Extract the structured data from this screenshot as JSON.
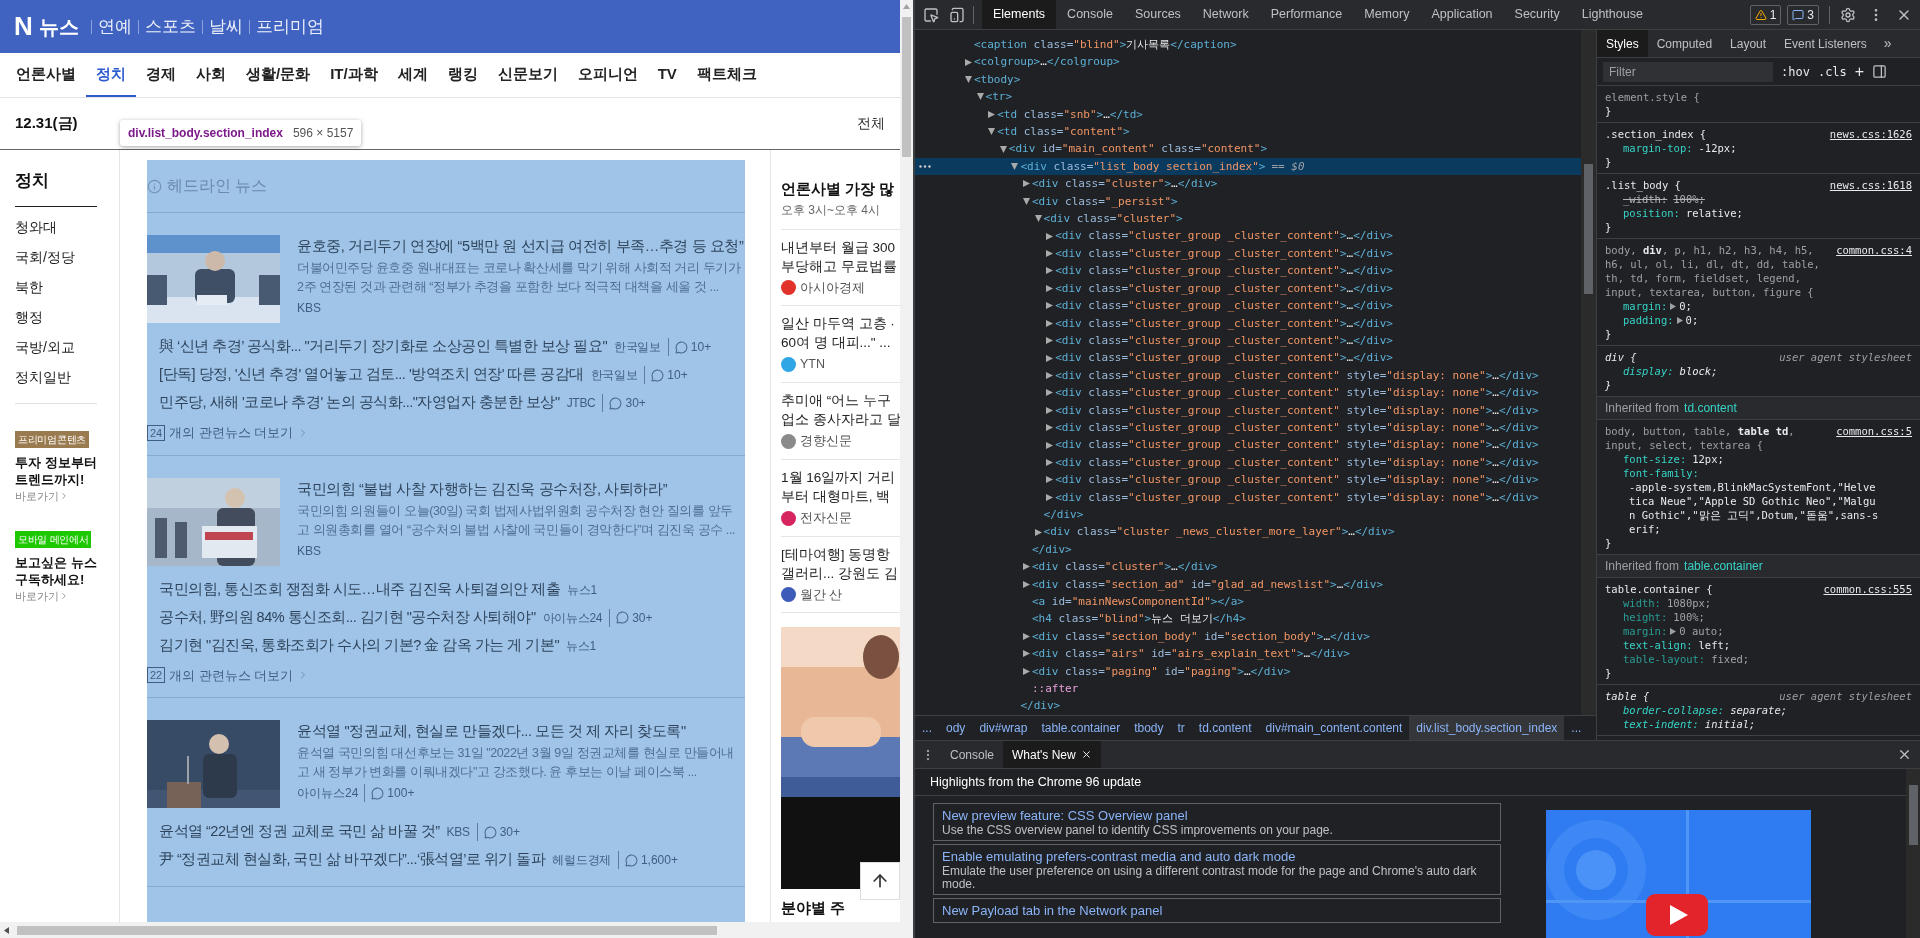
{
  "page": {
    "header": {
      "logo": "N",
      "title": "뉴스",
      "links": [
        "연예",
        "스포츠",
        "날씨",
        "프리미엄"
      ]
    },
    "nav": [
      {
        "label": "언론사별",
        "selected": false
      },
      {
        "label": "정치",
        "selected": true
      },
      {
        "label": "경제",
        "selected": false
      },
      {
        "label": "사회",
        "selected": false
      },
      {
        "label": "생활/문화",
        "selected": false
      },
      {
        "label": "IT/과학",
        "selected": false
      },
      {
        "label": "세계",
        "selected": false
      },
      {
        "label": "랭킹",
        "selected": false
      },
      {
        "label": "신문보기",
        "selected": false
      },
      {
        "label": "오피니언",
        "selected": false
      },
      {
        "label": "TV",
        "selected": false
      },
      {
        "label": "팩트체크",
        "selected": false
      }
    ],
    "date": "12.31(금)",
    "view_all": "전체",
    "inspect_tooltip": {
      "selector": "div.list_body.section_index",
      "size": "596 × 5157"
    },
    "sidebar": {
      "heading": "정치",
      "items": [
        "청와대",
        "국회/정당",
        "북한",
        "행정",
        "국방/외교",
        "정치일반"
      ],
      "promos": [
        {
          "badge": "프리미엄콘텐츠",
          "color": "#9a7a4f",
          "text": "투자 정보부터 트렌드까지!",
          "link": "바로가기"
        },
        {
          "badge": "모바일 메인에서",
          "color": "#1ec800",
          "text": "보고싶은 뉴스 구독하세요!",
          "link": "바로가기"
        }
      ]
    },
    "headline": {
      "title": "헤드라인 뉴스",
      "clusters": [
        {
          "title": "윤호중, 거리두기 연장에 “5백만 원 선지급 여전히 부족…추경 등 요청”",
          "summary": "더불어민주당 윤호중 원내대표는 코로나 확산세를 막기 위해 사회적 거리 두기가 2주 연장된 것과 관련해 “정부가 추경을 포함한 보다 적극적 대책을 세울 것 ...",
          "press": "KBS",
          "related": [
            {
              "title": "與 ‘신년 추경’ 공식화... \"거리두기 장기화로 소상공인 특별한 보상 필요\"",
              "press": "한국일보",
              "comments": "10+"
            },
            {
              "title": "[단독] 당정, '신년 추경' 열어놓고 검토... '방역조치 연장' 따른 공감대",
              "press": "한국일보",
              "comments": "10+"
            },
            {
              "title": "민주당, 새해 '코로나 추경' 논의 공식화...\"자영업자 충분한 보상\"",
              "press": "JTBC",
              "comments": "30+"
            }
          ],
          "more_count": "24",
          "more_label": "개의 관련뉴스 더보기"
        },
        {
          "title": "국민의힘 “불법 사찰 자행하는 김진욱 공수처장, 사퇴하라”",
          "summary": "국민의힘 의원들이 오늘(30일) 국회 법제사법위원회 공수처장 현안 질의를 앞두고 의원총회를 열어 “공수처의 불법 사찰에 국민들이 경악한다”며 김진욱 공수 ...",
          "press": "KBS",
          "related": [
            {
              "title": "국민의힘, 통신조회 쟁점화 시도…내주 김진욱 사퇴결의안 제출",
              "press": "뉴스1"
            },
            {
              "title": "공수처, 野의원 84% 통신조회... 김기현 \"공수처장 사퇴해야\"",
              "press": "아이뉴스24",
              "comments": "30+"
            },
            {
              "title": "김기현 \"김진욱, 통화조회가 수사의 기본? 金 감옥 가는 게 기본\"",
              "press": "뉴스1"
            }
          ],
          "more_count": "22",
          "more_label": "개의 관련뉴스 더보기"
        },
        {
          "title": "윤석열 \"정권교체, 현실로 만들겠다... 모든 것 제 자리 찾도록\"",
          "summary": "윤석열 국민의힘 대선후보는 31일 \"2022년 3월 9일 정권교체를 현실로 만들어내고 새 정부가 변화를 이뤄내겠다\"고 강조했다. 윤 후보는 이날 페이스북 ...",
          "press": "아이뉴스24",
          "comments": "100+",
          "related": [
            {
              "title": "윤석열 “22년엔 정권 교체로 국민 삶 바꿀 것”",
              "press": "KBS",
              "comments": "30+"
            },
            {
              "title": "尹 “정권교체 현실화, 국민 삶 바꾸겠다”...‘張석열’로 위기 돌파",
              "press": "헤럴드경제",
              "comments": "1,600+"
            }
          ]
        }
      ]
    },
    "ranking": {
      "title": "언론사별 가장 많",
      "subtitle": "오후 3시~오후 4시",
      "items": [
        {
          "lines": [
            "내년부터 월급 300",
            "부당해고 무료법률"
          ],
          "press": "아시아경제",
          "color": "#e0322b"
        },
        {
          "lines": [
            "일산 마두역 고층 ·",
            "60여 명 대피...\" ..."
          ],
          "press": "YTN",
          "color": "#2ea6e6"
        },
        {
          "lines": [
            "추미애 “어느 누구",
            "업소 종사자라고 달"
          ],
          "press": "경향신문",
          "color": "#8a8a8a"
        },
        {
          "lines": [
            "1월 16일까지 거리",
            "부터 대형마트, 백"
          ],
          "press": "전자신문",
          "color": "#d6245e"
        },
        {
          "lines": [
            "[테마여행] 동명항",
            "갤러리... 강원도 김"
          ],
          "press": "월간 산",
          "color": "#3d5bb8"
        }
      ],
      "section_title": "분야별 주"
    }
  },
  "devtools": {
    "tabs": [
      {
        "label": "Elements",
        "selected": true
      },
      {
        "label": "Console",
        "selected": false
      },
      {
        "label": "Sources",
        "selected": false
      },
      {
        "label": "Network",
        "selected": false
      },
      {
        "label": "Performance",
        "selected": false
      },
      {
        "label": "Memory",
        "selected": false
      },
      {
        "label": "Application",
        "selected": false
      },
      {
        "label": "Security",
        "selected": false
      },
      {
        "label": "Lighthouse",
        "selected": false
      }
    ],
    "warnings": "1",
    "messages": "3",
    "dom_tree": [
      {
        "text": "<caption class=\"blind\">기사목록</caption>",
        "kind": "leaf",
        "selected": false
      },
      {
        "text": "<colgroup>…</colgroup>",
        "kind": "node",
        "expanded": false,
        "selected": false
      },
      {
        "text": "<tbody>",
        "kind": "node",
        "expanded": true,
        "selected": false,
        "children": [
          {
            "text": "<tr>",
            "kind": "node",
            "expanded": true,
            "selected": false,
            "children": [
              {
                "text": "<td class=\"snb\">…</td>",
                "kind": "node",
                "expanded": false,
                "selected": false
              },
              {
                "text": "<td class=\"content\">",
                "kind": "node",
                "expanded": true,
                "selected": false,
                "children": [
                  {
                    "text": "<div id=\"main_content\" class=\"content\">",
                    "kind": "node",
                    "expanded": true,
                    "selected": false,
                    "children": [
                      {
                        "text": "<div class=\"list_body section_index\">",
                        "kind": "node",
                        "expanded": true,
                        "selected": true,
                        "console_ref": "== $0",
                        "close": "</div>",
                        "children": [
                          {
                            "text": "<div class=\"cluster\">…</div>",
                            "kind": "node",
                            "expanded": false,
                            "selected": false
                          },
                          {
                            "text": "<div class=\"_persist\">",
                            "kind": "node",
                            "expanded": true,
                            "selected": false,
                            "close": "</div>",
                            "children": [
                              {
                                "text": "<div class=\"cluster\">",
                                "kind": "node",
                                "expanded": true,
                                "selected": false,
                                "close": "</div>",
                                "children": [
                                  {
                                    "text": "<div class=\"cluster_group _cluster_content\">…</div>",
                                    "kind": "node",
                                    "expanded": false,
                                    "selected": false
                                  },
                                  {
                                    "text": "<div class=\"cluster_group _cluster_content\">…</div>",
                                    "kind": "node",
                                    "expanded": false,
                                    "selected": false
                                  },
                                  {
                                    "text": "<div class=\"cluster_group _cluster_content\">…</div>",
                                    "kind": "node",
                                    "expanded": false,
                                    "selected": false
                                  },
                                  {
                                    "text": "<div class=\"cluster_group _cluster_content\">…</div>",
                                    "kind": "node",
                                    "expanded": false,
                                    "selected": false
                                  },
                                  {
                                    "text": "<div class=\"cluster_group _cluster_content\">…</div>",
                                    "kind": "node",
                                    "expanded": false,
                                    "selected": false
                                  },
                                  {
                                    "text": "<div class=\"cluster_group _cluster_content\">…</div>",
                                    "kind": "node",
                                    "expanded": false,
                                    "selected": false
                                  },
                                  {
                                    "text": "<div class=\"cluster_group _cluster_content\">…</div>",
                                    "kind": "node",
                                    "expanded": false,
                                    "selected": false
                                  },
                                  {
                                    "text": "<div class=\"cluster_group _cluster_content\">…</div>",
                                    "kind": "node",
                                    "expanded": false,
                                    "selected": false
                                  },
                                  {
                                    "text": "<div class=\"cluster_group _cluster_content\" style=\"display: none\">…</div>",
                                    "kind": "node",
                                    "expanded": false,
                                    "selected": false
                                  },
                                  {
                                    "text": "<div class=\"cluster_group _cluster_content\" style=\"display: none\">…</div>",
                                    "kind": "node",
                                    "expanded": false,
                                    "selected": false
                                  },
                                  {
                                    "text": "<div class=\"cluster_group _cluster_content\" style=\"display: none\">…</div>",
                                    "kind": "node",
                                    "expanded": false,
                                    "selected": false
                                  },
                                  {
                                    "text": "<div class=\"cluster_group _cluster_content\" style=\"display: none\">…</div>",
                                    "kind": "node",
                                    "expanded": false,
                                    "selected": false
                                  },
                                  {
                                    "text": "<div class=\"cluster_group _cluster_content\" style=\"display: none\">…</div>",
                                    "kind": "node",
                                    "expanded": false,
                                    "selected": false
                                  },
                                  {
                                    "text": "<div class=\"cluster_group _cluster_content\" style=\"display: none\">…</div>",
                                    "kind": "node",
                                    "expanded": false,
                                    "selected": false
                                  },
                                  {
                                    "text": "<div class=\"cluster_group _cluster_content\" style=\"display: none\">…</div>",
                                    "kind": "node",
                                    "expanded": false,
                                    "selected": false
                                  },
                                  {
                                    "text": "<div class=\"cluster_group _cluster_content\" style=\"display: none\">…</div>",
                                    "kind": "node",
                                    "expanded": false,
                                    "selected": false
                                  }
                                ]
                              },
                              {
                                "text": "<div class=\"cluster _news_cluster_more_layer\">…</div>",
                                "kind": "node",
                                "expanded": false,
                                "selected": false
                              }
                            ]
                          },
                          {
                            "text": "<div class=\"cluster\">…</div>",
                            "kind": "node",
                            "expanded": false,
                            "selected": false
                          },
                          {
                            "text": "<div class=\"section_ad\" id=\"glad_ad_newslist\">…</div>",
                            "kind": "node",
                            "expanded": false,
                            "selected": false
                          },
                          {
                            "text": "<a id=\"mainNewsComponentId\"></a>",
                            "kind": "leaf",
                            "selected": false
                          },
                          {
                            "text": "<h4 class=\"blind\">뉴스 더보기</h4>",
                            "kind": "leaf",
                            "selected": false
                          },
                          {
                            "text": "<div class=\"section_body\" id=\"section_body\">…</div>",
                            "kind": "node",
                            "expanded": false,
                            "selected": false
                          },
                          {
                            "text": "<div class=\"airs\" id=\"airs_explain_text\">…</div>",
                            "kind": "node",
                            "expanded": false,
                            "selected": false
                          },
                          {
                            "text": "<div class=\"paging\" id=\"paging\">…</div>",
                            "kind": "node",
                            "expanded": false,
                            "selected": false
                          },
                          {
                            "text": "::after",
                            "kind": "pseudo",
                            "selected": false
                          }
                        ]
                      }
                    ]
                  }
                ]
              }
            ]
          }
        ]
      }
    ],
    "breadcrumbs": [
      {
        "label": "...",
        "selected": false
      },
      {
        "label": "ody",
        "selected": false
      },
      {
        "label": "div#wrap",
        "selected": false
      },
      {
        "label": "table.container",
        "selected": false
      },
      {
        "label": "tbody",
        "selected": false
      },
      {
        "label": "tr",
        "selected": false
      },
      {
        "label": "td.content",
        "selected": false
      },
      {
        "label": "div#main_content.content",
        "selected": false
      },
      {
        "label": "div.list_body.section_index",
        "selected": true
      },
      {
        "label": "...",
        "selected": false
      }
    ],
    "styles": {
      "tabs": [
        {
          "label": "Styles",
          "selected": true
        },
        {
          "label": "Computed",
          "selected": false
        },
        {
          "label": "Layout",
          "selected": false
        },
        {
          "label": "Event Listeners",
          "selected": false
        }
      ],
      "more": "»",
      "filter_placeholder": "Filter",
      "hov": ":hov",
      "cls": ".cls",
      "add": "+",
      "sections": [
        {
          "kind": "rule",
          "selector": "element.style {",
          "matched": false,
          "user_agent": false,
          "close": "}"
        },
        {
          "kind": "rule",
          "selector": ".section_index {",
          "matched": true,
          "user_agent": false,
          "source": "news.css:1626",
          "properties": [
            {
              "name": "margin-top:",
              "value": "-12px;",
              "expandable": false,
              "overridden": false,
              "inactive": false
            }
          ],
          "close": "}"
        },
        {
          "kind": "rule",
          "selector": ".list_body {",
          "matched": true,
          "user_agent": false,
          "source": "news.css:1618",
          "properties": [
            {
              "name": "_width:",
              "value": "100%;",
              "expandable": false,
              "overridden": true,
              "inactive": false
            },
            {
              "name": "position:",
              "value": "relative;",
              "expandable": false,
              "overridden": false,
              "inactive": false
            }
          ],
          "close": "}"
        },
        {
          "kind": "rule",
          "selector": "body, **div**, p, h1, h2, h3, h4, h5, h6, ul, ol, li, dl, dt, dd, table, th, td, form, fieldset, legend, input, textarea, button, figure {",
          "matched": false,
          "user_agent": false,
          "source": "common.css:4",
          "properties": [
            {
              "name": "margin:",
              "value": "0;",
              "expandable": true,
              "overridden": false,
              "inactive": false
            },
            {
              "name": "padding:",
              "value": "0;",
              "expandable": true,
              "overridden": false,
              "inactive": false
            }
          ],
          "close": "}"
        },
        {
          "kind": "rule",
          "selector": "div {",
          "matched": true,
          "user_agent": true,
          "source": "user agent stylesheet",
          "properties": [
            {
              "name": "display:",
              "value": "block;",
              "expandable": false,
              "overridden": false,
              "inactive": false
            }
          ],
          "close": "}"
        },
        {
          "kind": "inherited",
          "label": "Inherited from",
          "target": "td.content"
        },
        {
          "kind": "rule",
          "selector": "body, button, table, **table td**, input, select, textarea {",
          "matched": false,
          "user_agent": false,
          "source": "common.css:5",
          "properties": [
            {
              "name": "font-size:",
              "value": "12px;",
              "expandable": false,
              "overridden": false,
              "inactive": false
            },
            {
              "name": "font-family:",
              "value": "-apple-system,BlinkMacSystemFont,\"Helvetica Neue\",\"Apple SD Gothic Neo\",\"Malgun Gothic\",\"맑은 고딕\",Dotum,\"돋움\",sans-serif;",
              "expandable": false,
              "overridden": false,
              "inactive": false
            }
          ],
          "close": "}"
        },
        {
          "kind": "inherited",
          "label": "Inherited from",
          "target": "table.container"
        },
        {
          "kind": "rule",
          "selector": "table.container {",
          "matched": true,
          "user_agent": false,
          "source": "common.css:555",
          "properties": [
            {
              "name": "width:",
              "value": "1080px;",
              "expandable": false,
              "overridden": false,
              "inactive": true
            },
            {
              "name": "height:",
              "value": "100%;",
              "expandable": false,
              "overridden": false,
              "inactive": true
            },
            {
              "name": "margin:",
              "value": "0 auto;",
              "expandable": true,
              "overridden": false,
              "inactive": true
            },
            {
              "name": "text-align:",
              "value": "left;",
              "expandable": false,
              "overridden": false,
              "inactive": false
            },
            {
              "name": "table-layout:",
              "value": "fixed;",
              "expandable": false,
              "overridden": false,
              "inactive": true
            }
          ],
          "close": "}"
        },
        {
          "kind": "rule",
          "selector": "table {",
          "matched": true,
          "user_agent": true,
          "source": "user agent stylesheet",
          "properties": [
            {
              "name": "border-collapse:",
              "value": "separate;",
              "expandable": false,
              "overridden": false,
              "inactive": false
            },
            {
              "name": "text-indent:",
              "value": "initial;",
              "expandable": false,
              "overridden": false,
              "inactive": false
            }
          ]
        }
      ]
    },
    "drawer": {
      "tabs": [
        {
          "label": "Console",
          "selected": false,
          "closable": false
        },
        {
          "label": "What's New",
          "selected": true,
          "closable": true
        }
      ],
      "title": "Highlights from the Chrome 96 update",
      "cards": [
        {
          "title": "New preview feature: CSS Overview panel",
          "description": "Use the CSS overview panel to identify CSS improvements on your page."
        },
        {
          "title": "Enable emulating prefers-contrast media and auto dark mode",
          "description": "Emulate the user preference on using a different contrast mode for the page and Chrome's auto dark mode."
        },
        {
          "title": "New Payload tab in the Network panel"
        }
      ]
    }
  }
}
